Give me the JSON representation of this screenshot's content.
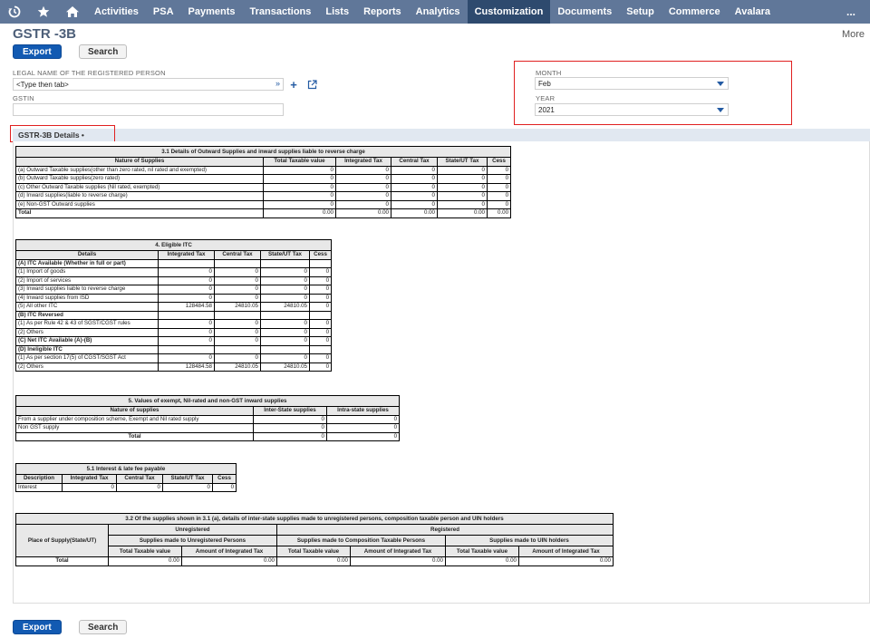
{
  "nav": {
    "items": [
      "Activities",
      "PSA",
      "Payments",
      "Transactions",
      "Lists",
      "Reports",
      "Analytics",
      "Customization",
      "Documents",
      "Setup",
      "Commerce",
      "Avalara"
    ],
    "active": "Customization",
    "more": "..."
  },
  "page": {
    "title": "GSTR -3B",
    "more": "More"
  },
  "buttons": {
    "export": "Export",
    "search": "Search"
  },
  "form": {
    "legal_name_label": "LEGAL NAME OF THE REGISTERED PERSON",
    "legal_name_value": "<Type then tab>",
    "gstin_label": "GSTIN",
    "gstin_value": "",
    "month_label": "MONTH",
    "month_value": "Feb",
    "year_label": "YEAR",
    "year_value": "2021"
  },
  "tab": {
    "label": "GSTR-3B Details •"
  },
  "t31": {
    "caption": "3.1 Details of Outward Supplies and inward supplies liable to reverse charge",
    "headers": [
      "Nature of Supplies",
      "Total Taxable value",
      "Integrated Tax",
      "Central Tax",
      "State/UT Tax",
      "Cess"
    ],
    "rows": [
      [
        "(a) Outward Taxable supplies(other than zero rated, nil rated and exempted)",
        "0",
        "0",
        "0",
        "0",
        "0"
      ],
      [
        "(b) Outward Taxable supplies(zero rated)",
        "0",
        "0",
        "0",
        "0",
        "0"
      ],
      [
        "(c) Other Outward Taxable supplies (Nil rated, exempted)",
        "0",
        "0",
        "0",
        "0",
        "0"
      ],
      [
        "(d) Inward supplies(liable to reverse charge)",
        "0",
        "0",
        "0",
        "0",
        "0"
      ],
      [
        "(e) Non-GST Outward supplies",
        "0",
        "0",
        "0",
        "0",
        "0"
      ],
      [
        "Total",
        "0.00",
        "0.00",
        "0.00",
        "0.00",
        "0.00"
      ]
    ]
  },
  "t4": {
    "caption": "4. Eligible ITC",
    "headers": [
      "Details",
      "Integrated Tax",
      "Central Tax",
      "State/UT Tax",
      "Cess"
    ],
    "rows": [
      [
        "(A) ITC Available (Whether in full or part)",
        "",
        "",
        "",
        ""
      ],
      [
        "(1) Import of goods",
        "0",
        "0",
        "0",
        "0"
      ],
      [
        "(2) Import of services",
        "0",
        "0",
        "0",
        "0"
      ],
      [
        "(3) Inward supplies liable to reverse charge",
        "0",
        "0",
        "0",
        "0"
      ],
      [
        "(4) Inward supplies from ISD",
        "0",
        "0",
        "0",
        "0"
      ],
      [
        "(5) All other ITC",
        "128484.58",
        "24810.05",
        "24810.05",
        "0"
      ],
      [
        "(B) ITC Reversed",
        "",
        "",
        "",
        ""
      ],
      [
        "(1) As per Rule 42 & 43 of SGST/CGST rules",
        "0",
        "0",
        "0",
        "0"
      ],
      [
        "(2) Others",
        "0",
        "0",
        "0",
        "0"
      ],
      [
        "(C) Net ITC Available (A)-(B)",
        "0",
        "0",
        "0",
        "0"
      ],
      [
        "(D) Ineligible ITC",
        "",
        "",
        "",
        ""
      ],
      [
        "(1) As per section 17(5) of CGST/SGST Act",
        "0",
        "0",
        "0",
        "0"
      ],
      [
        "(2) Others",
        "128484.58",
        "24810.05",
        "24810.05",
        "0"
      ]
    ]
  },
  "t5": {
    "caption": "5. Values of exempt, Nil-rated and non-GST inward supplies",
    "headers": [
      "Nature of supplies",
      "Inter-State supplies",
      "Intra-state supplies"
    ],
    "rows": [
      [
        "From a supplier under composition scheme, Exempt and Nil rated supply",
        "0",
        "0"
      ],
      [
        "Non GST supply",
        "0",
        "0"
      ],
      [
        "Total",
        "0",
        "0"
      ]
    ]
  },
  "t51": {
    "caption": "5.1 Interest & late fee payable",
    "headers": [
      "Description",
      "Integrated Tax",
      "Central Tax",
      "State/UT Tax",
      "Cess"
    ],
    "rows": [
      [
        "Interest",
        "0",
        "0",
        "0",
        "0"
      ]
    ]
  },
  "t32": {
    "caption": "3.2 Of the supplies shown in 3.1 (a), details of inter-state supplies made to unregistered persons, composition taxable person and UIN holders",
    "group_unregistered": "Unregistered",
    "group_registered": "Registered",
    "place_header": "Place of Supply(State/UT)",
    "sub_unreg": "Supplies made to Unregistered Persons",
    "sub_comp": "Supplies made to Composition Taxable Persons",
    "sub_uin": "Supplies made to UIN holders",
    "col_taxable": "Total Taxable value",
    "col_igst": "Amount of Integrated Tax",
    "total_label": "Total",
    "totals": [
      "0.00",
      "0.00",
      "0.00",
      "0.00",
      "0.00",
      "0.00"
    ]
  }
}
